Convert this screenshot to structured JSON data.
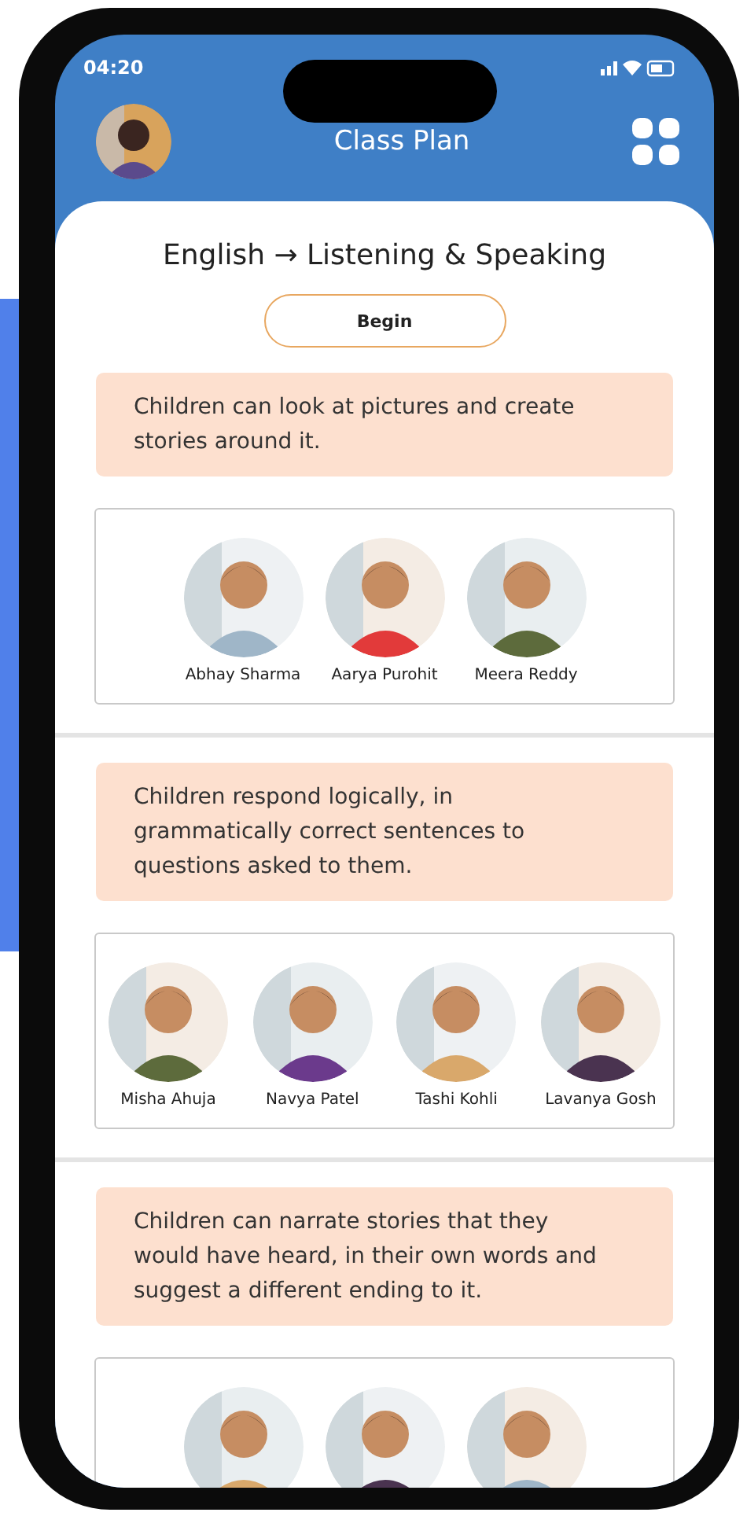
{
  "status_bar": {
    "time": "04:20"
  },
  "header": {
    "title": "Class Plan"
  },
  "lesson": {
    "title": "English → Listening & Speaking",
    "action": "Begin"
  },
  "sections": [
    {
      "objective": "Children can look at pictures and create stories around it.",
      "students": [
        {
          "kind": "picture",
          "name": "Abhay Sharma"
        },
        {
          "kind": "picture",
          "name": "Aarya Purohit"
        },
        {
          "kind": "picture",
          "name": "Meera Reddy"
        }
      ]
    },
    {
      "objective": "Children respond logically, in grammatically correct sentences to questions asked to them.",
      "students": [
        {
          "kind": "picture",
          "name": "Misha Ahuja"
        },
        {
          "kind": "picture",
          "name": "Navya Patel"
        },
        {
          "kind": "picture",
          "name": "Tashi Kohli"
        },
        {
          "kind": "picture",
          "name": "Lavanya Gosh"
        }
      ]
    },
    {
      "objective": "Children can narrate stories that they would have heard, in their own words and suggest a different ending to it."
    }
  ]
}
